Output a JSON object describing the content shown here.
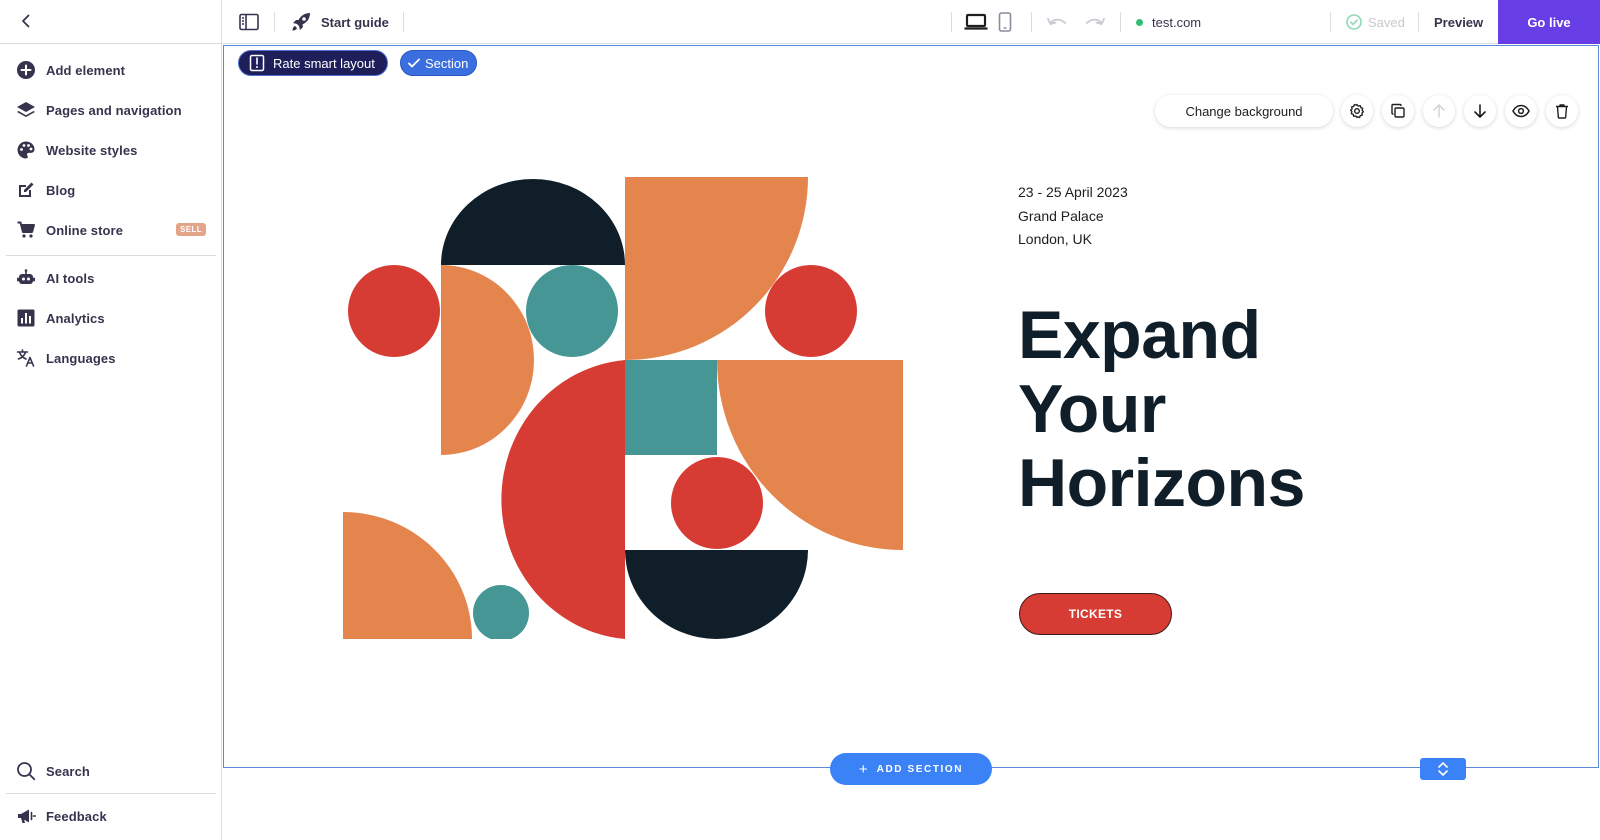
{
  "sidebar": {
    "items": [
      {
        "label": "Add element",
        "icon": "plus-circle-icon"
      },
      {
        "label": "Pages and navigation",
        "icon": "layers-icon"
      },
      {
        "label": "Website styles",
        "icon": "palette-icon"
      },
      {
        "label": "Blog",
        "icon": "edit-icon"
      },
      {
        "label": "Online store",
        "icon": "cart-icon",
        "badge": "SELL"
      },
      {
        "label": "AI tools",
        "icon": "robot-icon"
      },
      {
        "label": "Analytics",
        "icon": "bar-chart-icon"
      },
      {
        "label": "Languages",
        "icon": "translate-icon"
      }
    ],
    "search_label": "Search",
    "feedback_label": "Feedback"
  },
  "topbar": {
    "start_guide": "Start guide",
    "url": "test.com",
    "saved": "Saved",
    "preview": "Preview",
    "go_live": "Go live"
  },
  "canvas": {
    "rate_label": "Rate smart layout",
    "section_label": "Section",
    "change_background": "Change background",
    "event": {
      "date": "23 - 25 April 2023",
      "venue": "Grand Palace",
      "city": "London, UK"
    },
    "headline": [
      "Expand",
      "Your",
      "Horizons"
    ],
    "tickets": "TICKETS",
    "add_section": "ADD SECTION"
  },
  "colors": {
    "accent": "#673de6",
    "blue": "#3b82f6",
    "navy": "#0f1e28",
    "orange": "#e5854e",
    "red": "#d63c33",
    "teal": "#459694",
    "status_green": "#2fbf71"
  }
}
